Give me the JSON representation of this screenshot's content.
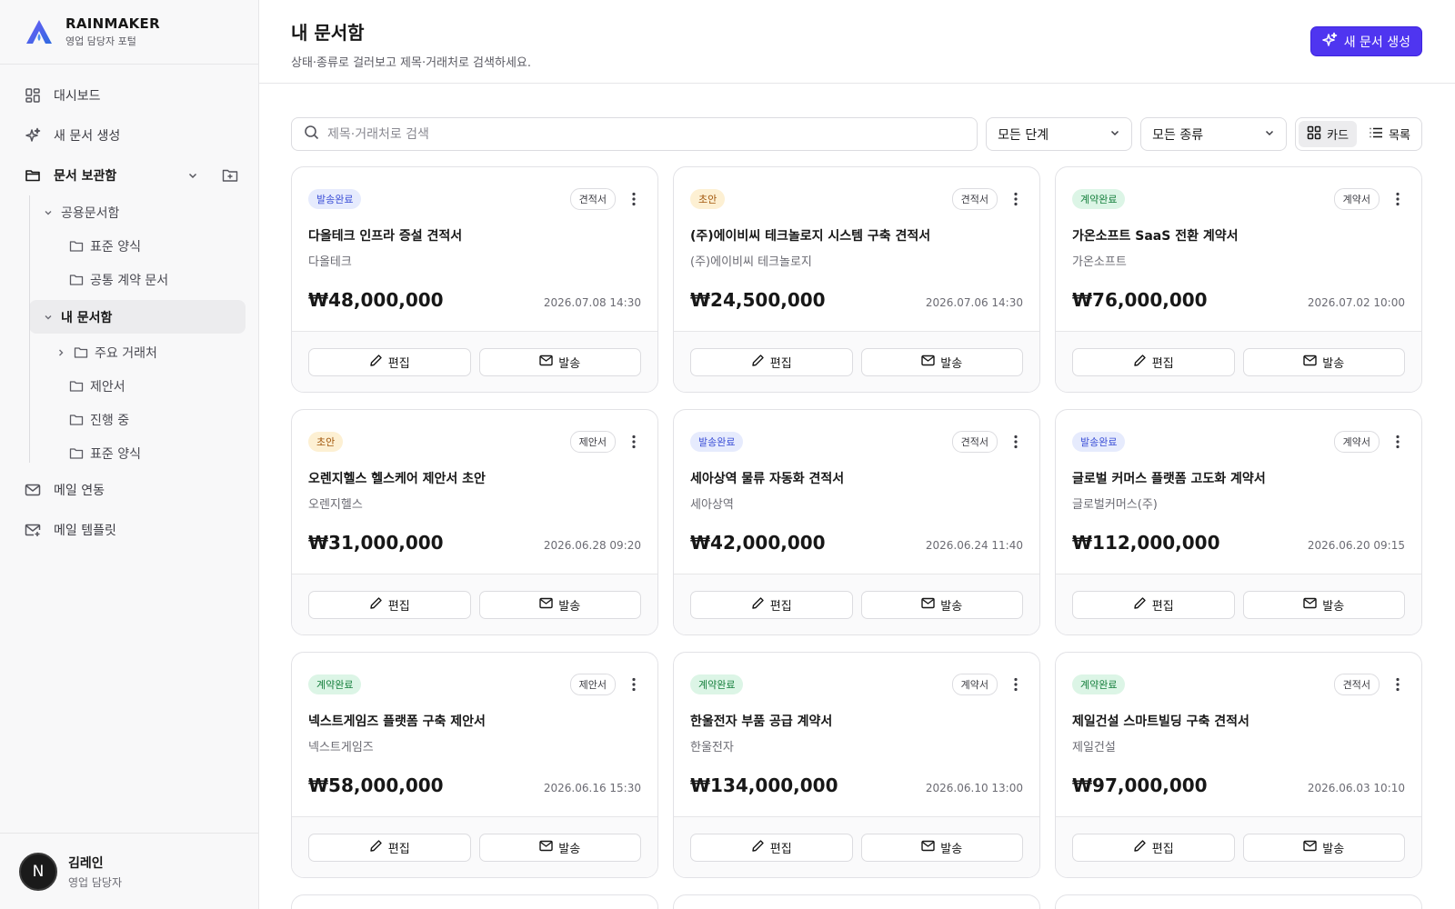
{
  "brand": {
    "name": "RAINMAKER",
    "subtitle": "영업 담당자 포털"
  },
  "nav": {
    "dashboard": "대시보드",
    "new_doc": "새 문서 생성",
    "doc_box": "문서 보관함",
    "shared": "공용문서함",
    "shared_children": [
      "표준 양식",
      "공통 계약 문서"
    ],
    "my_box": "내 문서함",
    "my_children": [
      "주요 거래처",
      "제안서",
      "진행 중",
      "표준 양식"
    ],
    "mail_link": "메일 연동",
    "mail_template": "메일 템플릿"
  },
  "user": {
    "initial": "N",
    "name": "김레인",
    "role": "영업 담당자"
  },
  "header": {
    "title": "내 문서함",
    "subtitle": "상태·종류로 걸러보고 제목·거래처로 검색하세요.",
    "new_button": "새 문서 생성"
  },
  "toolbar": {
    "search_placeholder": "제목·거래처로 검색",
    "stage_select": "모든 단계",
    "type_select": "모든 종류",
    "view_card": "카드",
    "view_list": "목록"
  },
  "card_actions": {
    "edit": "편집",
    "send": "발송"
  },
  "documents": [
    {
      "status": "발송완료",
      "status_kind": "sent",
      "type": "견적서",
      "title": "다올테크 인프라 증설 견적서",
      "client": "다올테크",
      "amount": "₩48,000,000",
      "date": "2026.07.08 14:30"
    },
    {
      "status": "초안",
      "status_kind": "draft",
      "type": "견적서",
      "title": "(주)에이비씨 테크놀로지 시스템 구축 견적서",
      "client": "(주)에이비씨 테크놀로지",
      "amount": "₩24,500,000",
      "date": "2026.07.06 14:30"
    },
    {
      "status": "계약완료",
      "status_kind": "done",
      "type": "계약서",
      "title": "가온소프트 SaaS 전환 계약서",
      "client": "가온소프트",
      "amount": "₩76,000,000",
      "date": "2026.07.02 10:00"
    },
    {
      "status": "초안",
      "status_kind": "draft",
      "type": "제안서",
      "title": "오렌지헬스 헬스케어 제안서 초안",
      "client": "오렌지헬스",
      "amount": "₩31,000,000",
      "date": "2026.06.28 09:20"
    },
    {
      "status": "발송완료",
      "status_kind": "sent",
      "type": "견적서",
      "title": "세아상역 물류 자동화 견적서",
      "client": "세아상역",
      "amount": "₩42,000,000",
      "date": "2026.06.24 11:40"
    },
    {
      "status": "발송완료",
      "status_kind": "sent",
      "type": "계약서",
      "title": "글로벌 커머스 플랫폼 고도화 계약서",
      "client": "글로벌커머스(주)",
      "amount": "₩112,000,000",
      "date": "2026.06.20 09:15"
    },
    {
      "status": "계약완료",
      "status_kind": "done",
      "type": "제안서",
      "title": "넥스트게임즈 플랫폼 구축 제안서",
      "client": "넥스트게임즈",
      "amount": "₩58,000,000",
      "date": "2026.06.16 15:30"
    },
    {
      "status": "계약완료",
      "status_kind": "done",
      "type": "계약서",
      "title": "한울전자 부품 공급 계약서",
      "client": "한울전자",
      "amount": "₩134,000,000",
      "date": "2026.06.10 13:00"
    },
    {
      "status": "계약완료",
      "status_kind": "done",
      "type": "견적서",
      "title": "제일건설 스마트빌딩 구축 견적서",
      "client": "제일건설",
      "amount": "₩97,000,000",
      "date": "2026.06.03 10:10"
    }
  ]
}
